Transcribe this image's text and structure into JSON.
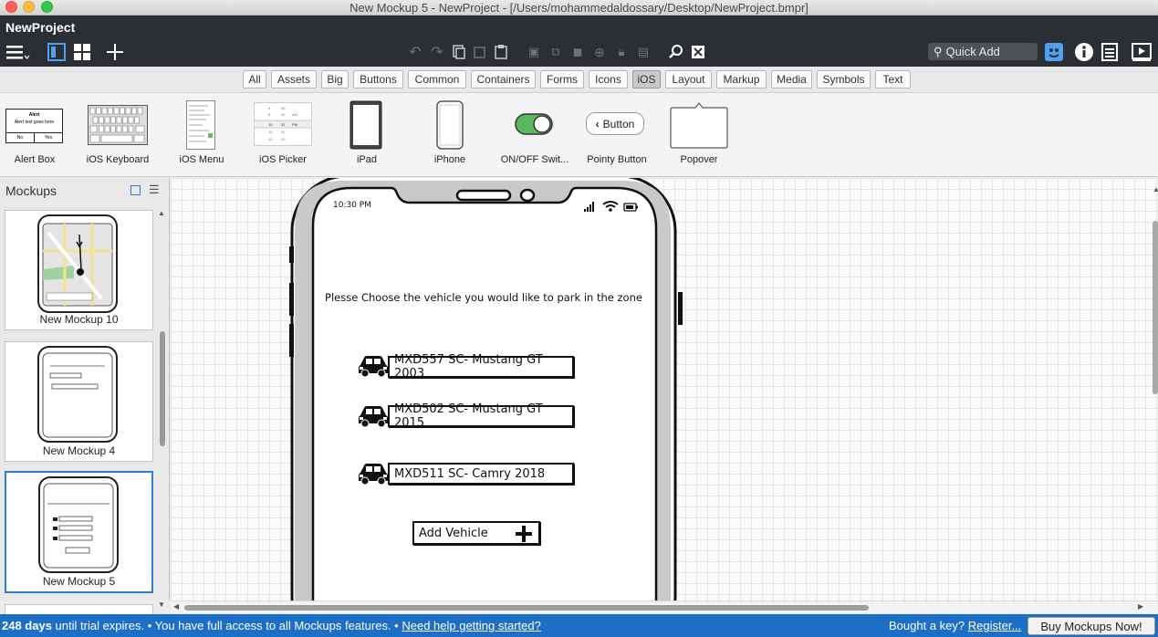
{
  "window": {
    "title": "New Mockup 5 - NewProject - [/Users/mohammedaldossary/Desktop/NewProject.bmpr]"
  },
  "app": {
    "project_name": "NewProject"
  },
  "toolbar": {
    "quick_add": "Quick Add"
  },
  "categories": [
    "All",
    "Assets",
    "Big",
    "Buttons",
    "Common",
    "Containers",
    "Forms",
    "Icons",
    "iOS",
    "Layout",
    "Markup",
    "Media",
    "Symbols",
    "Text"
  ],
  "selected_category": "iOS",
  "components": [
    {
      "label": "Alert Box"
    },
    {
      "label": "iOS Keyboard"
    },
    {
      "label": "iOS Menu"
    },
    {
      "label": "iOS Picker"
    },
    {
      "label": "iPad"
    },
    {
      "label": "iPhone"
    },
    {
      "label": "ON/OFF Swit..."
    },
    {
      "label": "Pointy Button",
      "button_text": "Button"
    },
    {
      "label": "Popover"
    }
  ],
  "alert_preview": {
    "title": "Alert",
    "body": "Alert text goes here",
    "no": "No",
    "yes": "Yes"
  },
  "sidebar": {
    "title": "Mockups",
    "mockups": [
      {
        "label": "New Mockup 10"
      },
      {
        "label": "New Mockup 4"
      },
      {
        "label": "New Mockup 5"
      }
    ]
  },
  "phone": {
    "time": "10:30 PM",
    "prompt": "Plesse Choose the vehicle you would like to park in the zone",
    "vehicles": [
      {
        "plate": "MXD557 SC- Mustang GT 2003"
      },
      {
        "plate": "MXD502 SC- Mustang GT 2015"
      },
      {
        "plate": "MXD511 SC- Camry 2018"
      }
    ],
    "add_vehicle": "Add Vehicle"
  },
  "status": {
    "days": "248 days",
    "text1": " until trial expires. • You have full access to all Mockups features. • ",
    "help_link": "Need help getting started?",
    "key_text": "Bought a key?",
    "register_link": "Register...",
    "buy_button": "Buy Mockups Now!"
  },
  "colors": {
    "accent": "#1d6fc5",
    "toggle_on": "#5cb85c",
    "appbar": "#2b2f33"
  }
}
